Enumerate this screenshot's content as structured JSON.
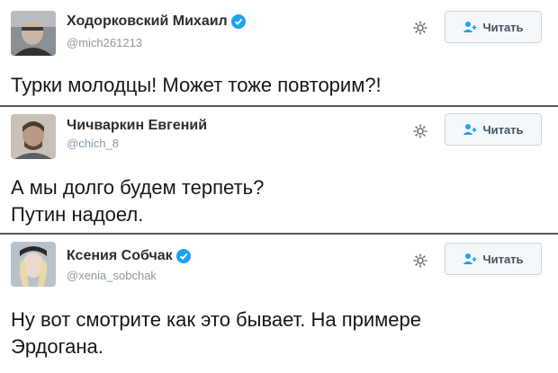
{
  "tweets": [
    {
      "name": "Ходорковский Михаил",
      "handle": "@mich261213",
      "verified": true,
      "follow_label": "Читать",
      "lines": [
        "Турки молодцы! Может тоже повторим?!"
      ]
    },
    {
      "name": "Чичваркин Евгений",
      "handle": "@chich_8",
      "verified": false,
      "follow_label": "Читать",
      "lines": [
        "А мы долго будем терпеть?",
        "Путин надоел."
      ]
    },
    {
      "name": "Ксения Собчак",
      "handle": "@xenia_sobchak",
      "verified": true,
      "follow_label": "Читать",
      "lines": [
        "Ну вот смотрите как это бывает. На примере",
        "Эрдогана."
      ]
    }
  ],
  "icons": {
    "settings": "gear-icon",
    "follow": "add-user-icon",
    "verified": "verified-badge-icon"
  },
  "colors": {
    "verified": "#1da1f2",
    "follow_icon": "#1da1f2",
    "handle": "#8899a6"
  }
}
